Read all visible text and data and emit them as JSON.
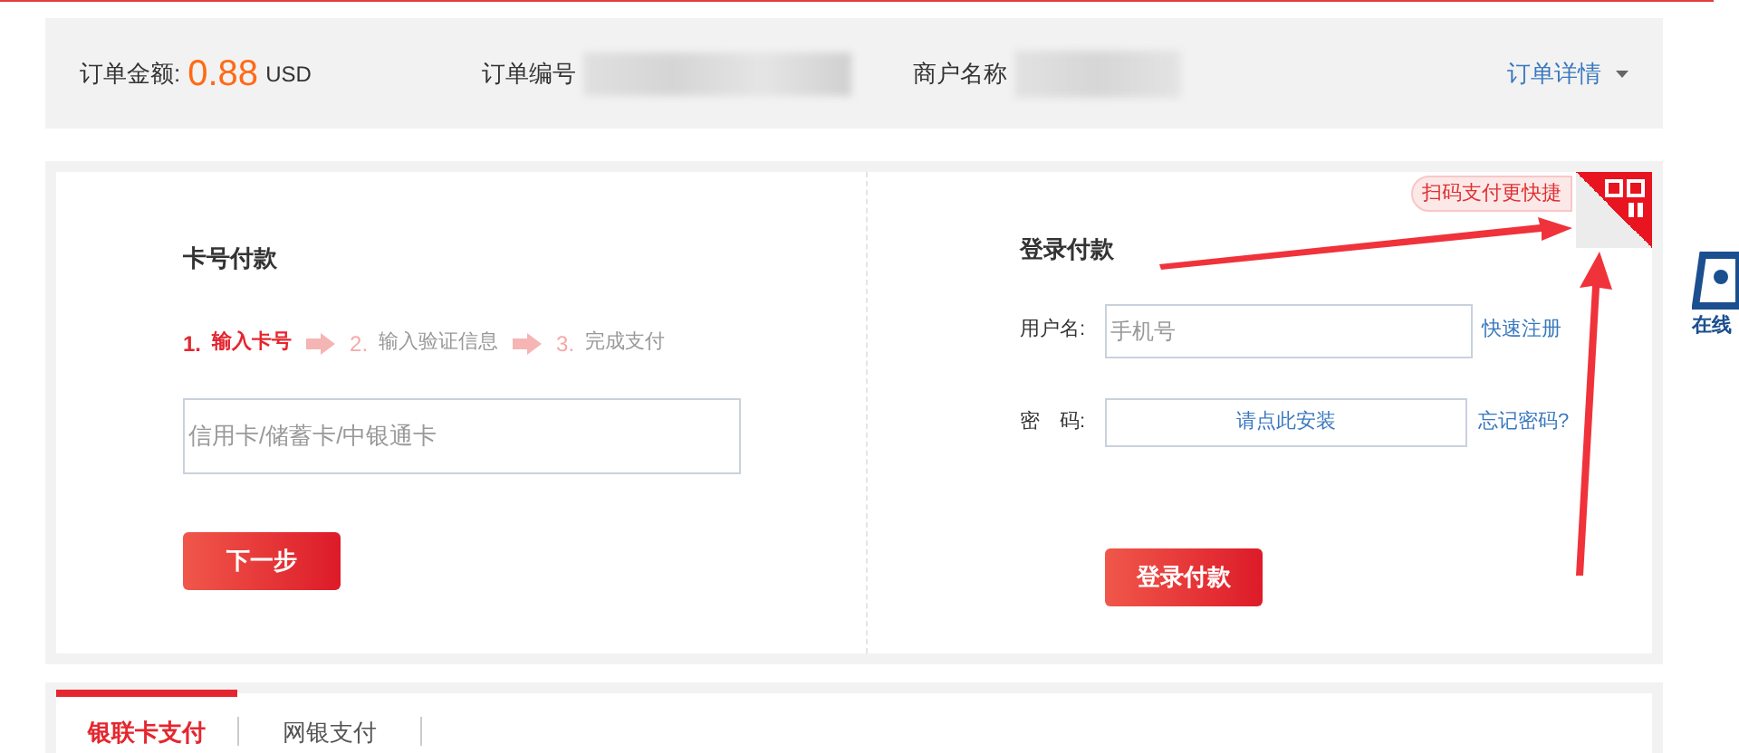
{
  "order_bar": {
    "amount_label": "订单金额:",
    "amount": "0.88",
    "currency": "USD",
    "order_no_label": "订单编号",
    "merchant_label": "商户名称",
    "details_link": "订单详情"
  },
  "card_pay": {
    "title": "卡号付款",
    "steps": [
      {
        "number": "1.",
        "label": "输入卡号",
        "selected": true
      },
      {
        "number": "2.",
        "label": "输入验证信息",
        "selected": false
      },
      {
        "number": "3.",
        "label": "完成支付",
        "selected": false
      }
    ],
    "card_field": {
      "placeholder": "信用卡/储蓄卡/中银通卡"
    },
    "next_button": "下一步"
  },
  "login_pay": {
    "title": "登录付款",
    "qr_hint": "扫码支付更快捷",
    "username_label": "用户名:",
    "username_field": {
      "placeholder": "手机号"
    },
    "register_link": "快速注册",
    "password_label": "密　码:",
    "install_button": "请点此安装",
    "forgot_link": "忘记密码?",
    "login_button": "登录付款"
  },
  "side_logo": {
    "caption": "在线"
  },
  "tabs": [
    {
      "label": "银联卡支付",
      "selected": true
    },
    {
      "label": "网银支付",
      "selected": false
    }
  ]
}
